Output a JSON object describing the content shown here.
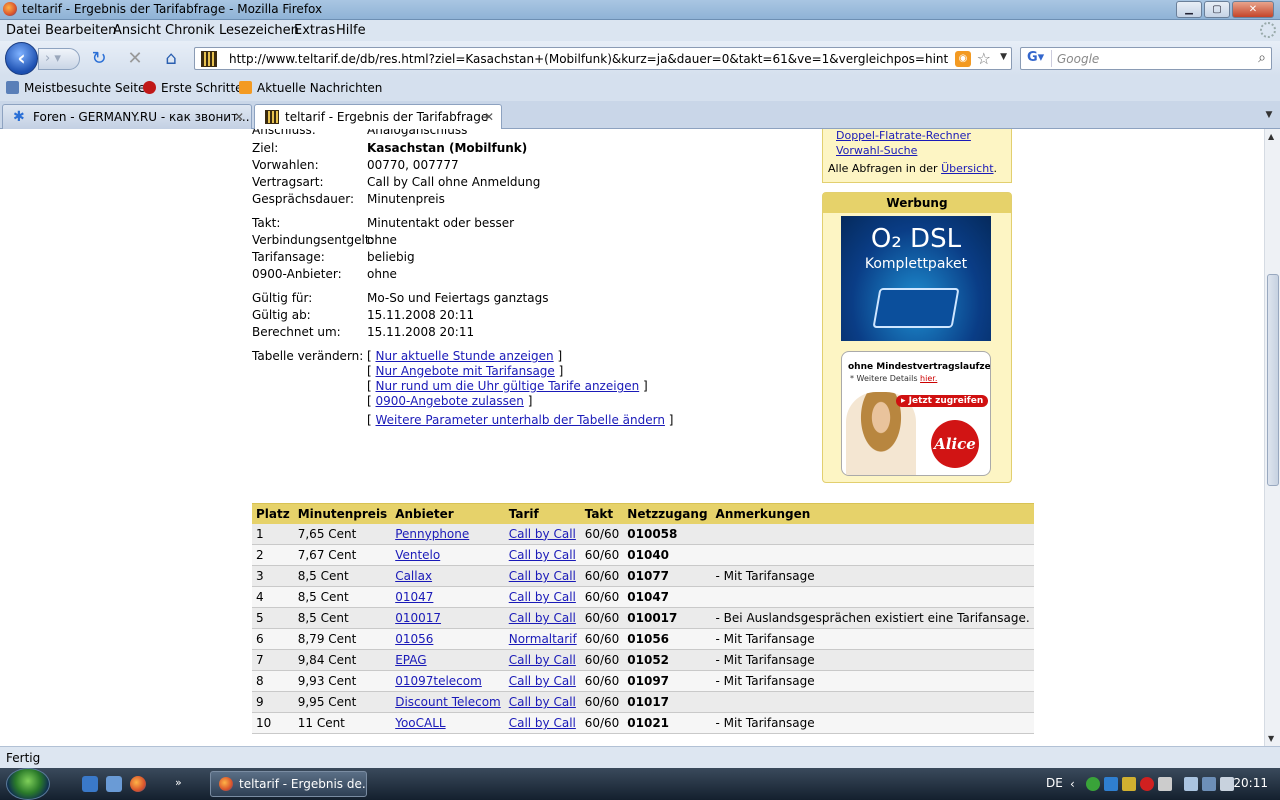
{
  "window": {
    "title": "teltarif - Ergebnis der Tarifabfrage - Mozilla Firefox"
  },
  "menu": [
    "Datei",
    "Bearbeiten",
    "Ansicht",
    "Chronik",
    "Lesezeichen",
    "Extras",
    "Hilfe"
  ],
  "nav": {
    "url": "http://www.teltarif.de/db/res.html?ziel=Kasachstan+(Mobilfunk)&kurz=ja&dauer=0&takt=61&ve=1&vergleichpos=hinten&von=Analo",
    "search_placeholder": "Google"
  },
  "bookmarks": [
    "Meistbesuchte Seiten",
    "Erste Schritte",
    "Aktuelle Nachrichten"
  ],
  "tabs": [
    {
      "label": "Foren - GERMANY.RU - как звонит...",
      "active": false
    },
    {
      "label": "teltarif - Ergebnis der Tarifabfrage",
      "active": true
    }
  ],
  "query": {
    "anschluss_label": "Anschluss:",
    "anschluss_value": "Analoganschluss",
    "rows": [
      {
        "label": "Ziel:",
        "value": "Kasachstan (Mobilfunk)"
      },
      {
        "label": "Vorwahlen:",
        "value": "00770, 007777"
      },
      {
        "label": "Vertragsart:",
        "value": "Call by Call ohne Anmeldung"
      },
      {
        "label": "Gesprächsdauer:",
        "value": "Minutenpreis"
      },
      {
        "label": "Takt:",
        "value": "Minutentakt oder besser"
      },
      {
        "label": "Verbindungsentgelt:",
        "value": "ohne"
      },
      {
        "label": "Tarifansage:",
        "value": "beliebig"
      },
      {
        "label": "0900-Anbieter:",
        "value": "ohne"
      },
      {
        "label": "Gültig für:",
        "value": "Mo-So und Feiertags ganztags"
      },
      {
        "label": "Gültig ab:",
        "value": "15.11.2008 20:11"
      },
      {
        "label": "Berechnet um:",
        "value": "15.11.2008 20:11"
      }
    ],
    "table_change_label": "Tabelle verändern:",
    "table_change_links": [
      "Nur aktuelle Stunde anzeigen",
      "Nur Angebote mit Tarifansage",
      "Nur rund um die Uhr gültige Tarife anzeigen",
      "0900-Angebote zulassen",
      "Weitere Parameter unterhalb der Tabelle ändern"
    ]
  },
  "sidebar": {
    "links": [
      "Doppel-Flatrate-Rechner",
      "Vorwahl-Suche"
    ],
    "all_queries_prefix": "Alle Abfragen in der ",
    "all_queries_link": "Übersicht",
    "all_queries_suffix": ".",
    "ad_heading": "Werbung",
    "ad1_brand": "O₂ DSL",
    "ad1_sub": "Komplettpaket",
    "ad2_line1": "ohne Mindestvertragslaufzeit*",
    "ad2_line2_prefix": "* Weitere Details ",
    "ad2_line2_link": "hier.",
    "ad2_button": "▸ Jetzt zugreifen",
    "ad2_logo": "Alice"
  },
  "results": {
    "headers": [
      "Platz",
      "Minutenpreis",
      "Anbieter",
      "Tarif",
      "Takt",
      "Netzzugang",
      "Anmerkungen"
    ],
    "rows": [
      [
        "1",
        "7,65 Cent",
        "Pennyphone",
        "Call by Call",
        "60/60",
        "010058",
        ""
      ],
      [
        "2",
        "7,67 Cent",
        "Ventelo",
        "Call by Call",
        "60/60",
        "01040",
        ""
      ],
      [
        "3",
        "8,5 Cent",
        "Callax",
        "Call by Call",
        "60/60",
        "01077",
        "- Mit Tarifansage"
      ],
      [
        "4",
        "8,5 Cent",
        "01047",
        "Call by Call",
        "60/60",
        "01047",
        ""
      ],
      [
        "5",
        "8,5 Cent",
        "010017",
        "Call by Call",
        "60/60",
        "010017",
        "-  Bei Auslandsgesprächen existiert eine Tarifansage."
      ],
      [
        "6",
        "8,79 Cent",
        "01056",
        "Normaltarif",
        "60/60",
        "01056",
        "- Mit Tarifansage"
      ],
      [
        "7",
        "9,84 Cent",
        "EPAG",
        "Call by Call",
        "60/60",
        "01052",
        "- Mit Tarifansage"
      ],
      [
        "8",
        "9,93 Cent",
        "01097telecom",
        "Call by Call",
        "60/60",
        "01097",
        "- Mit Tarifansage"
      ],
      [
        "9",
        "9,95 Cent",
        "Discount Telecom",
        "Call by Call",
        "60/60",
        "01017",
        ""
      ],
      [
        "10",
        "11 Cent",
        "YooCALL",
        "Call by Call",
        "60/60",
        "01021",
        "- Mit Tarifansage"
      ]
    ]
  },
  "status": "Fertig",
  "taskbar": {
    "task_label": "teltarif - Ergebnis de...",
    "lang": "DE",
    "clock": "20:11"
  }
}
